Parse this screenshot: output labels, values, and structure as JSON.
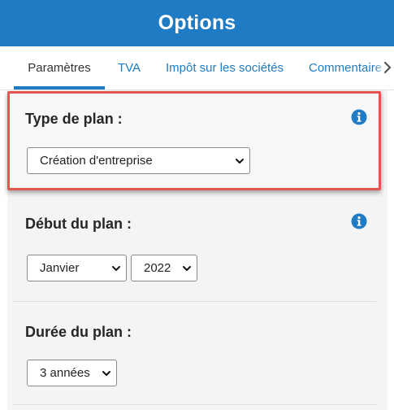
{
  "header": {
    "title": "Options"
  },
  "tabs": [
    {
      "label": "Paramètres",
      "active": true
    },
    {
      "label": "TVA"
    },
    {
      "label": "Impôt sur les sociétés"
    },
    {
      "label": "Commentaire"
    }
  ],
  "sections": {
    "plan_type": {
      "label": "Type de plan :",
      "selected": "Création d'entreprise",
      "highlighted": true
    },
    "plan_start": {
      "label": "Début du plan :",
      "month": "Janvier",
      "year": "2022"
    },
    "plan_duration": {
      "label": "Durée du plan :",
      "selected": "3 années"
    }
  },
  "colors": {
    "brand": "#1f7bc4",
    "highlight": "#e2564d",
    "panel": "#f4f4f4"
  },
  "icons": [
    "info-icon",
    "chevron-right-icon",
    "chevron-down-icon"
  ]
}
